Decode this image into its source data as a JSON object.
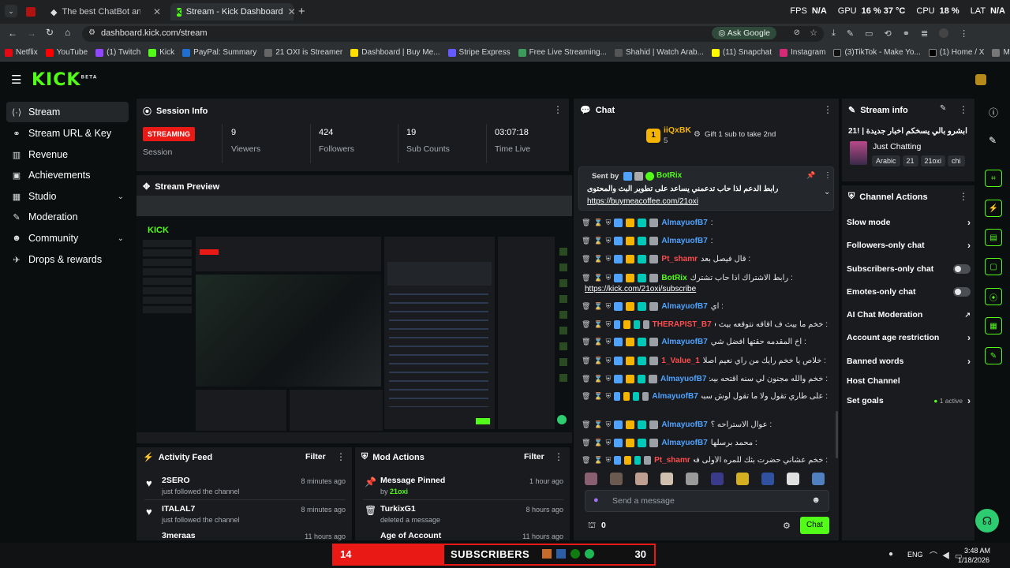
{
  "browser": {
    "tabs": [
      {
        "label": "The best ChatBot and Widg"
      },
      {
        "label": "Stream - Kick Dashboard"
      }
    ],
    "url": "dashboard.kick.com/stream",
    "ask_google": "Ask Google",
    "overlay": {
      "fps_label": "FPS",
      "fps_value": "N/A",
      "gpu_label": "GPU",
      "gpu_value": "16 % 37 °C",
      "cpu_label": "CPU",
      "cpu_value": "18 %",
      "lat_label": "LAT",
      "lat_value": "N/A"
    },
    "bookmarks": [
      "Netflix",
      "YouTube",
      "(1) Twitch",
      "Kick",
      "PayPal: Summary",
      "21 OXI is Streamer",
      "Dashboard | Buy Me...",
      "Stripe Express",
      "Free Live Streaming...",
      "Shahid | Watch Arab...",
      "(11) Snapchat",
      "Instagram",
      "(3)TikTok - Make Yo...",
      "(1) Home / X",
      "MT Store - مرحبا"
    ]
  },
  "sidebar": {
    "items": [
      {
        "label": "Stream",
        "icon": "link-icon"
      },
      {
        "label": "Stream URL & Key",
        "icon": "link-icon"
      },
      {
        "label": "Revenue",
        "icon": "bank-icon"
      },
      {
        "label": "Achievements",
        "icon": "trophy-icon"
      },
      {
        "label": "Studio",
        "icon": "studio-icon"
      },
      {
        "label": "Moderation",
        "icon": "wrench-icon"
      },
      {
        "label": "Community",
        "icon": "people-icon"
      },
      {
        "label": "Drops & rewards",
        "icon": "gift-icon"
      }
    ]
  },
  "session": {
    "title": "Session Info",
    "badge": "STREAMING",
    "badge_label": "Session",
    "stats": [
      {
        "value": "9",
        "label": "Viewers"
      },
      {
        "value": "424",
        "label": "Followers"
      },
      {
        "value": "19",
        "label": "Sub Counts"
      },
      {
        "value": "03:07:18",
        "label": "Time Live"
      }
    ]
  },
  "preview": {
    "title": "Stream Preview"
  },
  "activity": {
    "title": "Activity Feed",
    "filter": "Filter",
    "items": [
      {
        "name": "2SERO",
        "sub": "just followed the channel",
        "time": "8 minutes ago"
      },
      {
        "name": "ITALAL7",
        "sub": "just followed the channel",
        "time": "8 minutes ago"
      },
      {
        "name": "3meraas",
        "sub": "",
        "time": "11 hours ago"
      }
    ]
  },
  "mod": {
    "title": "Mod Actions",
    "filter": "Filter",
    "items": [
      {
        "name": "Message Pinned",
        "sub": "by ",
        "by": "21oxi",
        "time": "1 hour ago"
      },
      {
        "name": "TurkixG1",
        "sub": "deleted a message",
        "time": "8 hours ago"
      },
      {
        "name": "Age of Account",
        "sub": "",
        "time": "11 hours ago"
      }
    ]
  },
  "chat": {
    "title": "Chat",
    "gifter_name": "iiQxBK",
    "gifter_count": "5",
    "gift_text": "Gift 1 sub to take 2nd",
    "pinned": {
      "sent_by": "Sent by",
      "user": "BotRix",
      "text": "رابط الدعم لذا حاب تدعمني يساعد على تطوير البث والمحتوى",
      "link": "https://buymeacoffee.com/21oxi"
    },
    "messages": [
      {
        "user": "AlmayuofB7",
        "text": ":",
        "color": "#4fa3ff"
      },
      {
        "user": "AlmayuofB7",
        "text": ":",
        "color": "#4fa3ff"
      },
      {
        "user": "Pt_shamr",
        "text": ": قال فيصل بعد",
        "color": "#ff4d4d"
      },
      {
        "user": "BotRix",
        "text": ": رابط الاشتراك اذا حاب تشترك",
        "color": "#53fc18",
        "link": "https://kick.com/21oxi/subscribe"
      },
      {
        "user": "AlmayuofB7",
        "text": ": اي",
        "color": "#4fa3ff"
      },
      {
        "user": "THERAPIST_B7",
        "text": ": خخم ما بيث ف اقاقه نتوقعه بيث ف اقاه محمد",
        "color": "#ff4d4d"
      },
      {
        "user": "AlmayuofB7",
        "text": ": اخ المقدمه حقتها افضل شي",
        "color": "#4fa3ff"
      },
      {
        "user": "1_Value_1",
        "text": ": خلاص يا خخم رايك من رأي نعيم أصلا",
        "color": "#ff4d4d"
      },
      {
        "user": "AlmayuofB7",
        "text": ": خخم والله مجنون لي سنه اقتحه بيث",
        "color": "#4fa3ff"
      },
      {
        "user": "AlmayuofB7",
        "text": ": على طاري تقول ولا ما تقول لوش سبب كرهك للاسيا",
        "color": "#4fa3ff"
      },
      {
        "user": "AlmayuofB7",
        "text": ": عوال الاستراحه ؟",
        "color": "#4fa3ff"
      },
      {
        "user": "AlmayuofB7",
        "text": ": محمد برسلها",
        "color": "#4fa3ff"
      },
      {
        "user": "Pt_shamr",
        "text": ": خخم عشاني حضرت بثك للمره الأولى فحت تصرفها",
        "color": "#ff4d4d"
      }
    ],
    "placeholder": "Send a message",
    "points": "0",
    "send_label": "Chat"
  },
  "stream_info": {
    "title": "Stream info",
    "stream_title": "ابشرو بالي يسخكم اخبار جديدة | !21",
    "category": "Just Chatting",
    "tags": [
      "Arabic",
      "21",
      "21oxi",
      "chi"
    ]
  },
  "channel_actions": {
    "title": "Channel Actions",
    "items": [
      {
        "label": "Slow mode",
        "control": "arrow"
      },
      {
        "label": "Followers-only chat",
        "control": "arrow"
      },
      {
        "label": "Subscribers-only chat",
        "control": "toggle"
      },
      {
        "label": "Emotes-only chat",
        "control": "toggle"
      },
      {
        "label": "AI Chat Moderation",
        "control": "external"
      },
      {
        "label": "Account age restriction",
        "control": "arrow"
      },
      {
        "label": "Banned words",
        "control": "arrow"
      },
      {
        "label": "Host Channel",
        "control": "none"
      },
      {
        "label": "Set goals",
        "control": "arrow",
        "status": "1 active"
      }
    ]
  },
  "overlay_bar": {
    "left": "14",
    "label": "SUBSCRIBERS",
    "right": "30"
  },
  "taskbar": {
    "lang": "ENG",
    "time": "3:48 AM",
    "date": "1/18/2026"
  }
}
